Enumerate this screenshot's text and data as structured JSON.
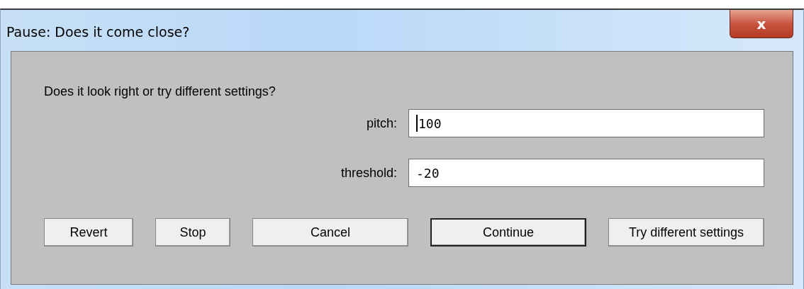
{
  "window": {
    "title": "Pause: Does it come close?",
    "close_label": "x"
  },
  "message": "Does it look right or try different settings?",
  "fields": [
    {
      "label": "pitch:",
      "value": "100",
      "focused": true
    },
    {
      "label": "threshold:",
      "value": "-20",
      "focused": false
    }
  ],
  "buttons": [
    {
      "label": "Revert",
      "default": false
    },
    {
      "label": "Stop",
      "default": false
    },
    {
      "label": "Cancel",
      "default": false
    },
    {
      "label": "Continue",
      "default": true
    },
    {
      "label": "Try different settings",
      "default": false
    }
  ]
}
